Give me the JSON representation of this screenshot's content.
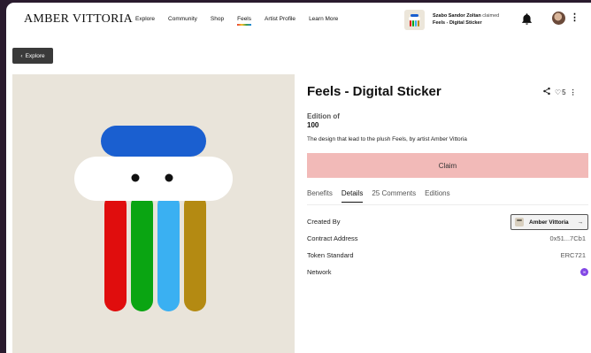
{
  "brand": "AMBER VITTORIA",
  "nav": [
    "Explore",
    "Community",
    "Shop",
    "Feels",
    "Artist Profile",
    "Learn More"
  ],
  "nav_active_index": 3,
  "notification": {
    "user": "Szabo Sandor Zoltan",
    "action": "claimed",
    "item": "Feels - Digital Sticker"
  },
  "header_icons": [
    "bell-icon",
    "avatar",
    "kebab-menu-icon"
  ],
  "back_button": {
    "icon": "chevron-left-icon",
    "label": "Explore"
  },
  "item": {
    "title": "Feels - Digital Sticker",
    "likes": "5",
    "edition_label": "Edition of",
    "edition_count": "100",
    "description": "The design that lead to the plush Feels, by artist Amber Vittoria",
    "claim_label": "Claim"
  },
  "artwork": {
    "background": "#e9e4da",
    "cap_color": "#1a5fd0",
    "leg_colors": [
      "#e00d0d",
      "#0aa512",
      "#3ab0f2",
      "#b48a12"
    ]
  },
  "tabs": [
    "Benefits",
    "Details",
    "25 Comments",
    "Editions"
  ],
  "active_tab_index": 1,
  "details": {
    "created_by_label": "Created By",
    "created_by_value": "Amber Vittoria",
    "contract_label": "Contract Address",
    "contract_value": "0x51...7Cb1",
    "token_label": "Token Standard",
    "token_value": "ERC721",
    "network_label": "Network",
    "network_icon": "polygon-icon"
  },
  "colors": {
    "claim_button": "#f2bab8",
    "back_button": "#3a3a3a",
    "network": "#8247e5"
  }
}
